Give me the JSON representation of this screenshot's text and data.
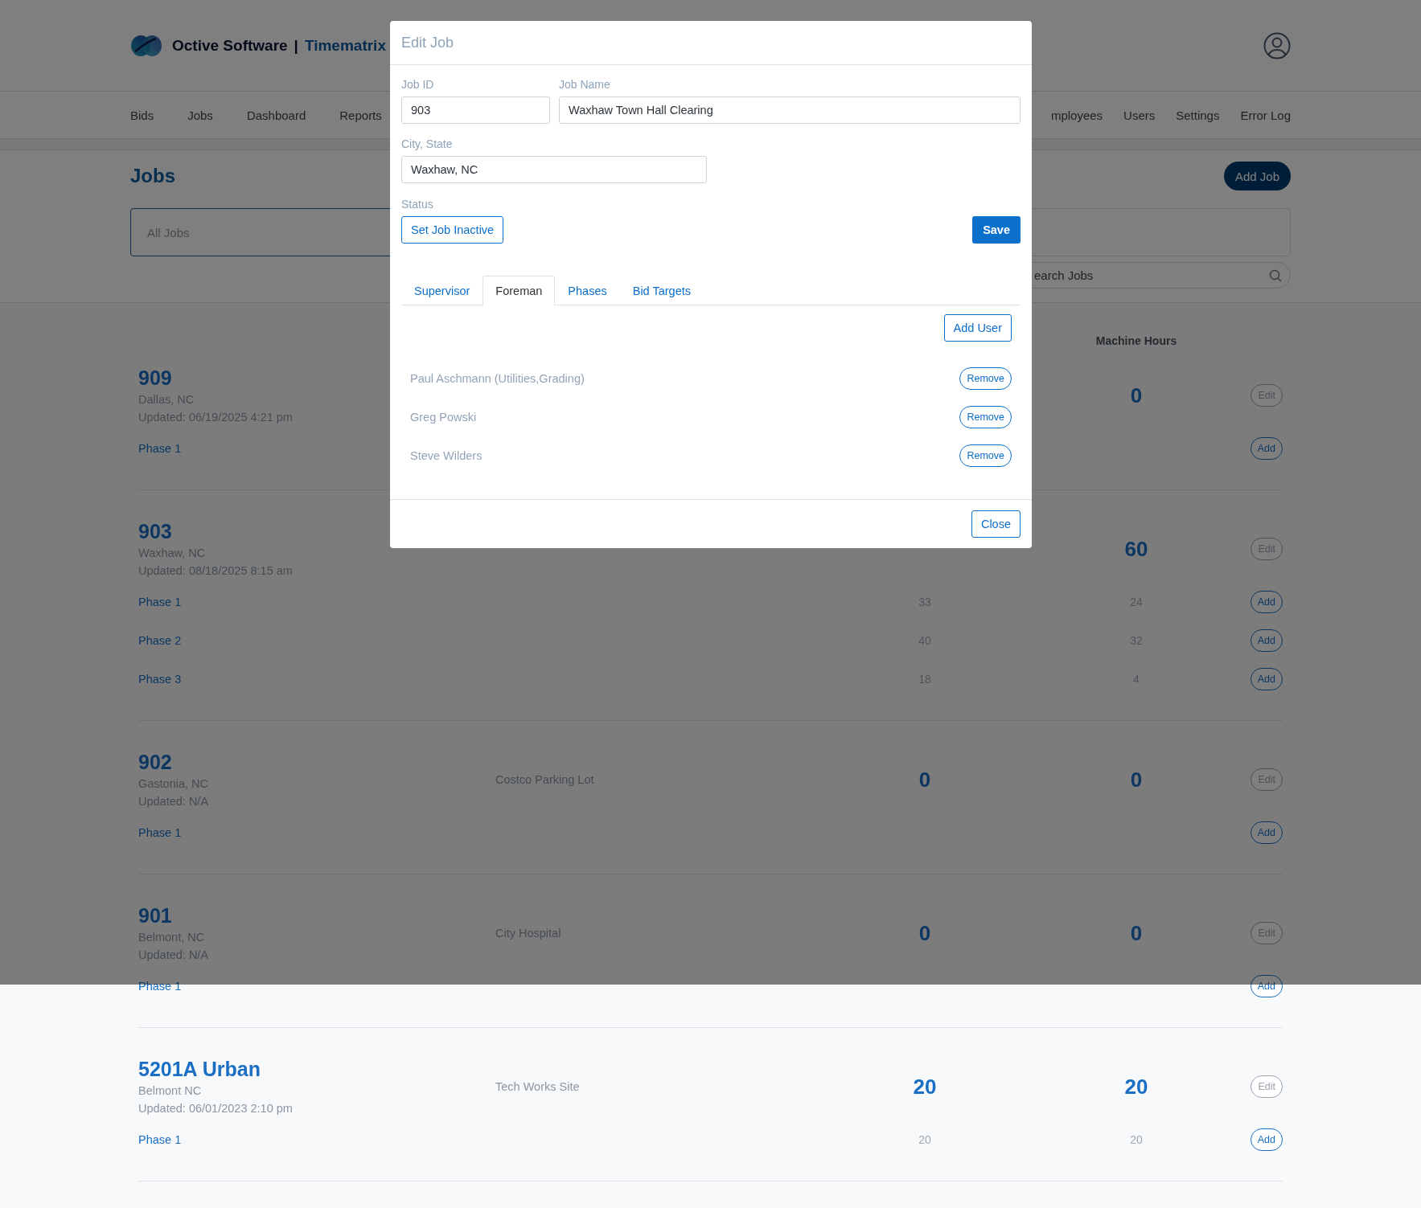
{
  "header": {
    "brand": "Octive Software",
    "separator": "|",
    "product": "Timematrix"
  },
  "nav": [
    {
      "label": "Bids"
    },
    {
      "label": "Jobs"
    },
    {
      "label": "Dashboard"
    },
    {
      "label": "Reports"
    },
    {
      "label": "mployees"
    },
    {
      "label": "Users"
    },
    {
      "label": "Settings"
    },
    {
      "label": "Error Log"
    }
  ],
  "page": {
    "title": "Jobs",
    "add_button": "Add Job",
    "filter": "All Jobs",
    "search": {
      "placeholder": "earch Jobs"
    }
  },
  "table": {
    "machine_hours_heading": "Machine Hours"
  },
  "jobs": [
    {
      "id": "909",
      "city": "Dallas, NC",
      "updated": "Updated: 06/19/2025 4:21 pm",
      "machine_hours": "0",
      "edit": "Edit",
      "phases": [
        {
          "name": "Phase 1",
          "action": "Add"
        }
      ]
    },
    {
      "id": "903",
      "city": "Waxhaw, NC",
      "updated": "Updated: 08/18/2025 8:15 am",
      "machine_hours": "60",
      "edit": "Edit",
      "phases": [
        {
          "name": "Phase 1",
          "labor_hours": "33",
          "machine_hours": "24",
          "action": "Add"
        },
        {
          "name": "Phase 2",
          "labor_hours": "40",
          "machine_hours": "32",
          "action": "Add"
        },
        {
          "name": "Phase 3",
          "labor_hours": "18",
          "machine_hours": "4",
          "action": "Add"
        }
      ]
    },
    {
      "id": "902",
      "city": "Gastonia, NC",
      "updated": "Updated: N/A",
      "name": "Costco Parking Lot",
      "labor_hours": "0",
      "machine_hours": "0",
      "edit": "Edit",
      "phases": [
        {
          "name": "Phase 1",
          "action": "Add"
        }
      ]
    },
    {
      "id": "901",
      "city": "Belmont, NC",
      "updated": "Updated: N/A",
      "name": "City Hospital",
      "labor_hours": "0",
      "machine_hours": "0",
      "edit": "Edit",
      "phases": [
        {
          "name": "Phase 1",
          "action": "Add"
        }
      ]
    },
    {
      "id": "5201A Urban",
      "city": "Belmont NC",
      "updated": "Updated: 06/01/2023 2:10 pm",
      "name": "Tech Works Site",
      "labor_hours": "20",
      "machine_hours": "20",
      "edit": "Edit",
      "phases": [
        {
          "name": "Phase 1",
          "labor_hours": "20",
          "machine_hours": "20",
          "action": "Add"
        }
      ]
    }
  ],
  "modal": {
    "title": "Edit Job",
    "fields": [
      {
        "label": "Job ID",
        "value": "903"
      },
      {
        "label": "Job Name",
        "value": "Waxhaw Town Hall Clearing"
      },
      {
        "label": "City, State",
        "value": "Waxhaw, NC"
      }
    ],
    "status_label": "Status",
    "status_button": "Set Job Inactive",
    "save_button": "Save",
    "tabs": [
      {
        "label": "Supervisor",
        "selected": false
      },
      {
        "label": "Foreman",
        "selected": true
      },
      {
        "label": "Phases",
        "selected": false
      },
      {
        "label": "Bid Targets",
        "selected": false
      }
    ],
    "add_user_button": "Add User",
    "users": [
      {
        "name": "Paul Aschmann (Utilities,Grading)",
        "action": "Remove"
      },
      {
        "name": "Greg Powski",
        "action": "Remove"
      },
      {
        "name": "Steve Wilders",
        "action": "Remove"
      }
    ],
    "close_button": "Close"
  }
}
